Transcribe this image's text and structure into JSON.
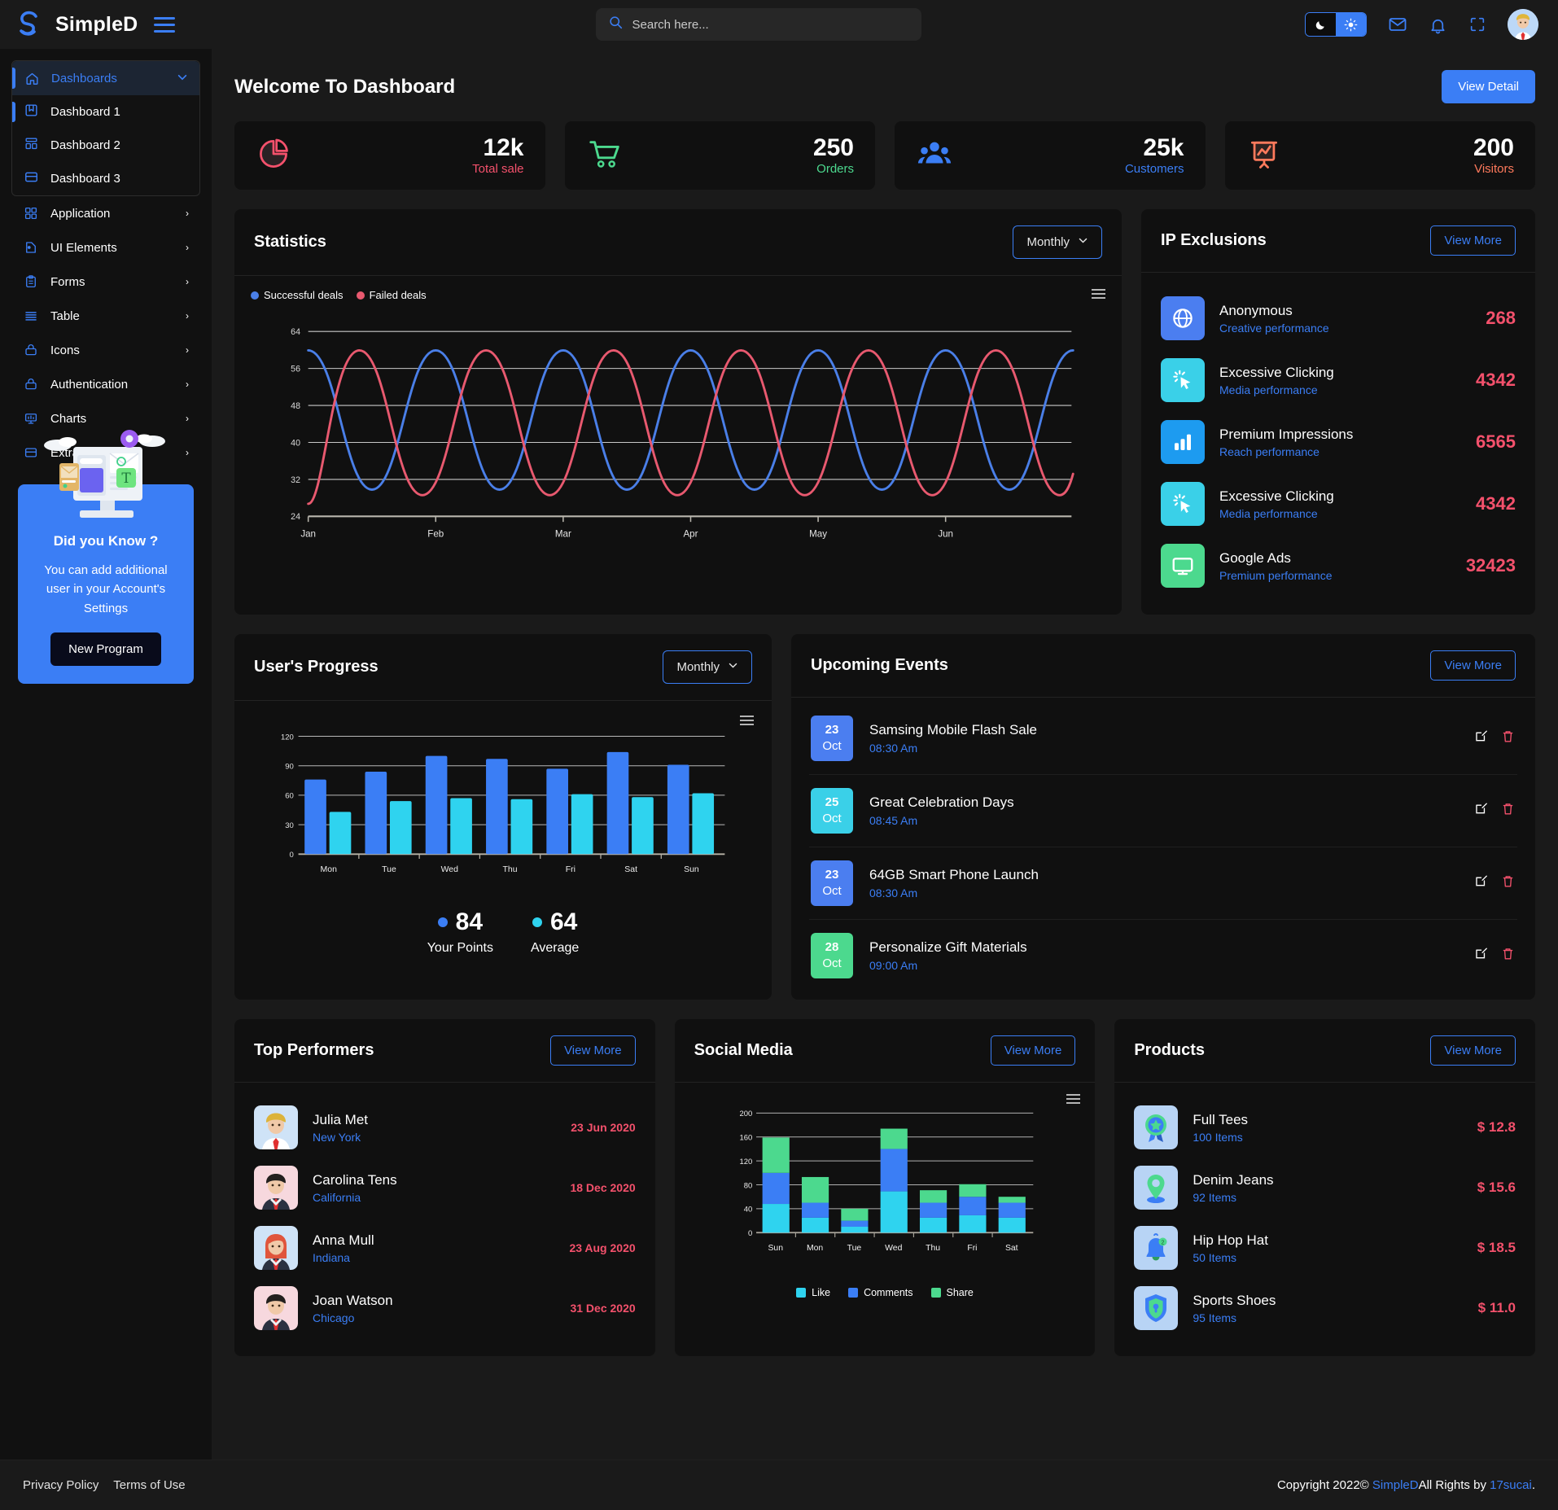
{
  "header": {
    "brand": "SimpleD",
    "search_placeholder": "Search here...",
    "search_value": "",
    "icons": [
      "moon-icon",
      "sun-icon",
      "mail-icon",
      "bell-icon",
      "fullscreen-icon",
      "avatar"
    ]
  },
  "sidebar": {
    "items": [
      {
        "label": "Dashboards",
        "icon": "home-icon",
        "active": true,
        "expandable": true
      },
      {
        "label": "Application",
        "icon": "grid-icon",
        "expandable": true
      },
      {
        "label": "UI Elements",
        "icon": "palette-icon",
        "expandable": true
      },
      {
        "label": "Forms",
        "icon": "clipboard-icon",
        "expandable": true
      },
      {
        "label": "Table",
        "icon": "lines-icon",
        "expandable": true
      },
      {
        "label": "Icons",
        "icon": "box-icon",
        "expandable": true
      },
      {
        "label": "Authentication",
        "icon": "lock-icon",
        "expandable": true
      },
      {
        "label": "Charts",
        "icon": "chart-icon",
        "expandable": true
      },
      {
        "label": "Extra Pages",
        "icon": "pages-icon",
        "expandable": true
      }
    ],
    "submenu": [
      {
        "label": "Dashboard 1",
        "icon": "bookmark-icon",
        "current": true
      },
      {
        "label": "Dashboard 2",
        "icon": "layout-icon"
      },
      {
        "label": "Dashboard 3",
        "icon": "card-icon"
      }
    ],
    "promo": {
      "title": "Did you Know ?",
      "text": "You can add additional user in your Account's Settings",
      "button": "New Program"
    }
  },
  "main": {
    "welcome_title": "Welcome To Dashboard",
    "view_detail_label": "View Detail",
    "stats": [
      {
        "value": "12k",
        "label": "Total sale",
        "icon": "pie-chart-icon",
        "color": "#f4516c"
      },
      {
        "value": "250",
        "label": "Orders",
        "icon": "cart-icon",
        "color": "#4cd98e"
      },
      {
        "value": "25k",
        "label": "Customers",
        "icon": "users-icon",
        "color": "#3b7ef5"
      },
      {
        "value": "200",
        "label": "Visitors",
        "icon": "presentation-icon",
        "color": "#ff7a5c"
      }
    ]
  },
  "statistics": {
    "title": "Statistics",
    "period": "Monthly",
    "menu_icon": "hamburger-menu-icon"
  },
  "ip_exclusions": {
    "title": "IP Exclusions",
    "view_more": "View More",
    "rows": [
      {
        "name": "Anonymous",
        "sub": "Creative performance",
        "value": "268",
        "icon": "globe-icon",
        "color": "#4b7ef0"
      },
      {
        "name": "Excessive Clicking",
        "sub": "Media performance",
        "value": "4342",
        "icon": "click-icon",
        "color": "#3ad0e8"
      },
      {
        "name": "Premium Impressions",
        "sub": "Reach performance",
        "value": "6565",
        "icon": "bars-icon",
        "color": "#1d9bf0"
      },
      {
        "name": "Excessive Clicking",
        "sub": "Media performance",
        "value": "4342",
        "icon": "click-icon",
        "color": "#3ad0e8"
      },
      {
        "name": "Google Ads",
        "sub": "Premium performance",
        "value": "32423",
        "icon": "monitor-icon",
        "color": "#4cd98e"
      }
    ]
  },
  "user_progress": {
    "title": "User's Progress",
    "period": "Monthly",
    "menu_icon": "hamburger-menu-icon",
    "summary": [
      {
        "value": "84",
        "label": "Your Points",
        "color": "#3b7ef5"
      },
      {
        "value": "64",
        "label": "Average",
        "color": "#2fd3ef"
      }
    ]
  },
  "events": {
    "title": "Upcoming Events",
    "view_more": "View More",
    "rows": [
      {
        "day": "23",
        "month": "Oct",
        "title": "Samsing Mobile Flash Sale",
        "time": "08:30 Am",
        "color": "#4b7ef0"
      },
      {
        "day": "25",
        "month": "Oct",
        "title": "Great Celebration Days",
        "time": "08:45 Am",
        "color": "#3ad0e8"
      },
      {
        "day": "23",
        "month": "Oct",
        "title": "64GB Smart Phone Launch",
        "time": "08:30 Am",
        "color": "#4b7ef0"
      },
      {
        "day": "28",
        "month": "Oct",
        "title": "Personalize Gift Materials",
        "time": "09:00 Am",
        "color": "#4cd98e"
      }
    ],
    "edit_icon": "edit-icon",
    "delete_icon": "trash-icon"
  },
  "top_performers": {
    "title": "Top Performers",
    "view_more": "View More",
    "rows": [
      {
        "name": "Julia Met",
        "location": "New York",
        "date": "23 Jun 2020",
        "avatar": "avatar-blonde-man"
      },
      {
        "name": "Carolina Tens",
        "location": "California",
        "date": "18 Dec 2020",
        "avatar": "avatar-dark-hair-man"
      },
      {
        "name": "Anna Mull",
        "location": "Indiana",
        "date": "23 Aug 2020",
        "avatar": "avatar-red-hair-woman"
      },
      {
        "name": "Joan Watson",
        "location": "Chicago",
        "date": "31 Dec 2020",
        "avatar": "avatar-dark-hair-man-2"
      }
    ]
  },
  "social_media": {
    "title": "Social Media",
    "view_more": "View More",
    "menu_icon": "hamburger-menu-icon"
  },
  "products": {
    "title": "Products",
    "view_more": "View More",
    "rows": [
      {
        "name": "Full Tees",
        "items": "100 Items",
        "price": "$ 12.8",
        "icon": "badge-icon"
      },
      {
        "name": "Denim Jeans",
        "items": "92 Items",
        "price": "$ 15.6",
        "icon": "pin-icon"
      },
      {
        "name": "Hip Hop Hat",
        "items": "50 Items",
        "price": "$ 18.5",
        "icon": "bell-3d-icon"
      },
      {
        "name": "Sports Shoes",
        "items": "95 Items",
        "price": "$ 11.0",
        "icon": "shield-icon"
      }
    ]
  },
  "footer": {
    "privacy": "Privacy Policy",
    "terms": "Terms of Use",
    "copyright_pre": "Copyright 2022© ",
    "brand": "SimpleD",
    "copyright_mid": "All Rights by ",
    "author": "17sucai",
    "copyright_end": "."
  },
  "chart_data": [
    {
      "type": "line",
      "title": "Statistics",
      "xlabel": "",
      "ylabel": "",
      "categories": [
        "Jan",
        "Feb",
        "Mar",
        "Apr",
        "May",
        "Jun"
      ],
      "ylim": [
        24,
        64
      ],
      "yticks": [
        24,
        32,
        40,
        48,
        56,
        64
      ],
      "grid": true,
      "legend_position": "top-left",
      "series": [
        {
          "name": "Successful deals",
          "color": "#4a7fe8",
          "values": [
            60,
            30,
            60,
            30,
            60,
            30,
            60,
            30,
            60,
            30,
            60
          ]
        },
        {
          "name": "Failed deals",
          "color": "#e8596f",
          "values": [
            28,
            60,
            29,
            60,
            29,
            60,
            29,
            60,
            29,
            60,
            29
          ]
        }
      ]
    },
    {
      "type": "bar",
      "title": "User's Progress",
      "categories": [
        "Mon",
        "Tue",
        "Wed",
        "Thu",
        "Fri",
        "Sat",
        "Sun"
      ],
      "ylim": [
        0,
        120
      ],
      "yticks": [
        0,
        30,
        60,
        90,
        120
      ],
      "grid": true,
      "series": [
        {
          "name": "Your Points",
          "color": "#3b7ef5",
          "values": [
            76,
            84,
            100,
            97,
            87,
            104,
            91
          ]
        },
        {
          "name": "Average",
          "color": "#2fd3ef",
          "values": [
            43,
            54,
            57,
            56,
            61,
            58,
            62
          ]
        }
      ]
    },
    {
      "type": "bar",
      "title": "Social Media",
      "stacked": true,
      "categories": [
        "Sun",
        "Mon",
        "Tue",
        "Wed",
        "Thu",
        "Fri",
        "Sat"
      ],
      "ylim": [
        0,
        200
      ],
      "yticks": [
        0,
        40,
        80,
        120,
        160,
        200
      ],
      "grid": true,
      "legend_position": "bottom",
      "series": [
        {
          "name": "Like",
          "color": "#2fd3ef",
          "values": [
            48,
            25,
            10,
            69,
            25,
            29,
            25
          ]
        },
        {
          "name": "Comments",
          "color": "#3b7ef5",
          "values": [
            52,
            25,
            10,
            71,
            25,
            31,
            25
          ]
        },
        {
          "name": "Share",
          "color": "#4cd98e",
          "values": [
            59,
            43,
            20,
            34,
            21,
            21,
            10
          ]
        }
      ]
    }
  ]
}
